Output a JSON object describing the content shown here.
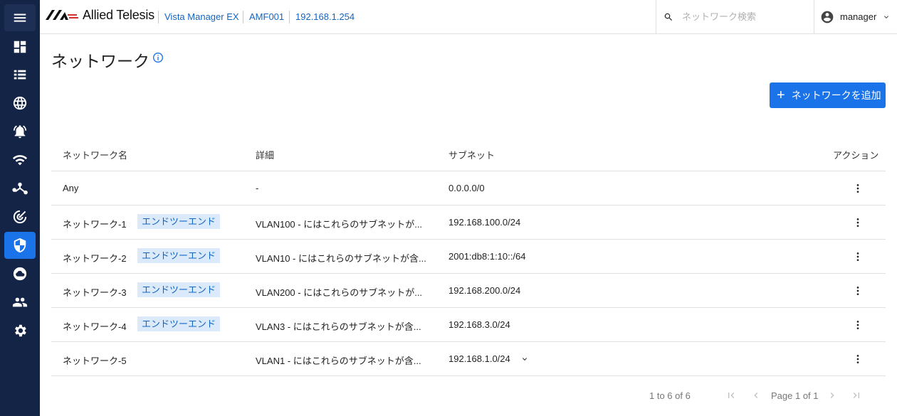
{
  "header": {
    "logo_text": "Allied Telesis",
    "breadcrumbs": [
      "Vista Manager EX",
      "AMF001",
      "192.168.1.254"
    ],
    "search_placeholder": "ネットワーク検索",
    "user": "manager"
  },
  "sidebar": {
    "items": [
      "menu-icon",
      "dashboard-icon",
      "list-icon",
      "globe-icon",
      "alarm-icon",
      "wifi-icon",
      "topology-icon",
      "radar-icon",
      "shield-icon",
      "cloud-icon",
      "users-icon",
      "settings-icon"
    ],
    "active": "shield-icon",
    "active_color": "#1a73e8",
    "background": "#142447"
  },
  "page": {
    "title": "ネットワーク",
    "add_button": "ネットワークを追加"
  },
  "table": {
    "columns": [
      "ネットワーク名",
      "詳細",
      "サブネット",
      "アクション"
    ],
    "rows": [
      {
        "name": "Any",
        "tag": "",
        "detail": "-",
        "subnet": "0.0.0.0/0"
      },
      {
        "name": "ネットワーク-1",
        "tag": "エンドツーエンド",
        "detail": "VLAN100 - にはこれらのサブネットが...",
        "subnet": "192.168.100.0/24"
      },
      {
        "name": "ネットワーク-2",
        "tag": "エンドツーエンド",
        "detail": "VLAN10 - にはこれらのサブネットが含...",
        "subnet": "2001:db8:1:10::/64"
      },
      {
        "name": "ネットワーク-3",
        "tag": "エンドツーエンド",
        "detail": "VLAN200 - にはこれらのサブネットが...",
        "subnet": "192.168.200.0/24"
      },
      {
        "name": "ネットワーク-4",
        "tag": "エンドツーエンド",
        "detail": "VLAN3 - にはこれらのサブネットが含...",
        "subnet": "192.168.3.0/24"
      },
      {
        "name": "ネットワーク-5",
        "tag": "",
        "detail": "VLAN1 - にはこれらのサブネットが含...",
        "subnet": "192.168.1.0/24"
      }
    ]
  },
  "pagination": {
    "range": "1 to 6 of 6",
    "page": "Page 1 of 1"
  }
}
